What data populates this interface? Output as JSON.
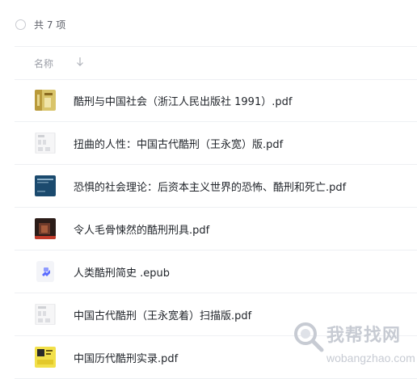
{
  "header": {
    "item_count": "共 7 项",
    "column_name": "名称"
  },
  "files": [
    {
      "name": "酷刑与中国社会（浙江人民出版社 1991）.pdf",
      "icon": "book-cover-gold-thumbnail"
    },
    {
      "name": "扭曲的人性：中国古代酷刑（王永宽）版.pdf",
      "icon": "document-page-thumbnail"
    },
    {
      "name": "恐惧的社会理论：后资本主义世界的恐怖、酷刑和死亡.pdf",
      "icon": "book-cover-blue-thumbnail"
    },
    {
      "name": "令人毛骨悚然的酷刑刑具.pdf",
      "icon": "book-cover-dark-thumbnail"
    },
    {
      "name": "人类酷刑简史 .epub",
      "icon": "epub-file-icon"
    },
    {
      "name": "中国古代酷刑（王永宽着）扫描版.pdf",
      "icon": "document-page-thumbnail"
    },
    {
      "name": "中国历代酷刑实录.pdf",
      "icon": "book-cover-yellow-thumbnail"
    }
  ],
  "watermark": {
    "text_cn": "我帮找网",
    "text_en": "wobangzhao.com"
  },
  "colors": {
    "text_primary": "#1f2329",
    "text_secondary": "#9a9da6",
    "divider": "#eef0f3",
    "epub_accent": "#5b6cff"
  }
}
